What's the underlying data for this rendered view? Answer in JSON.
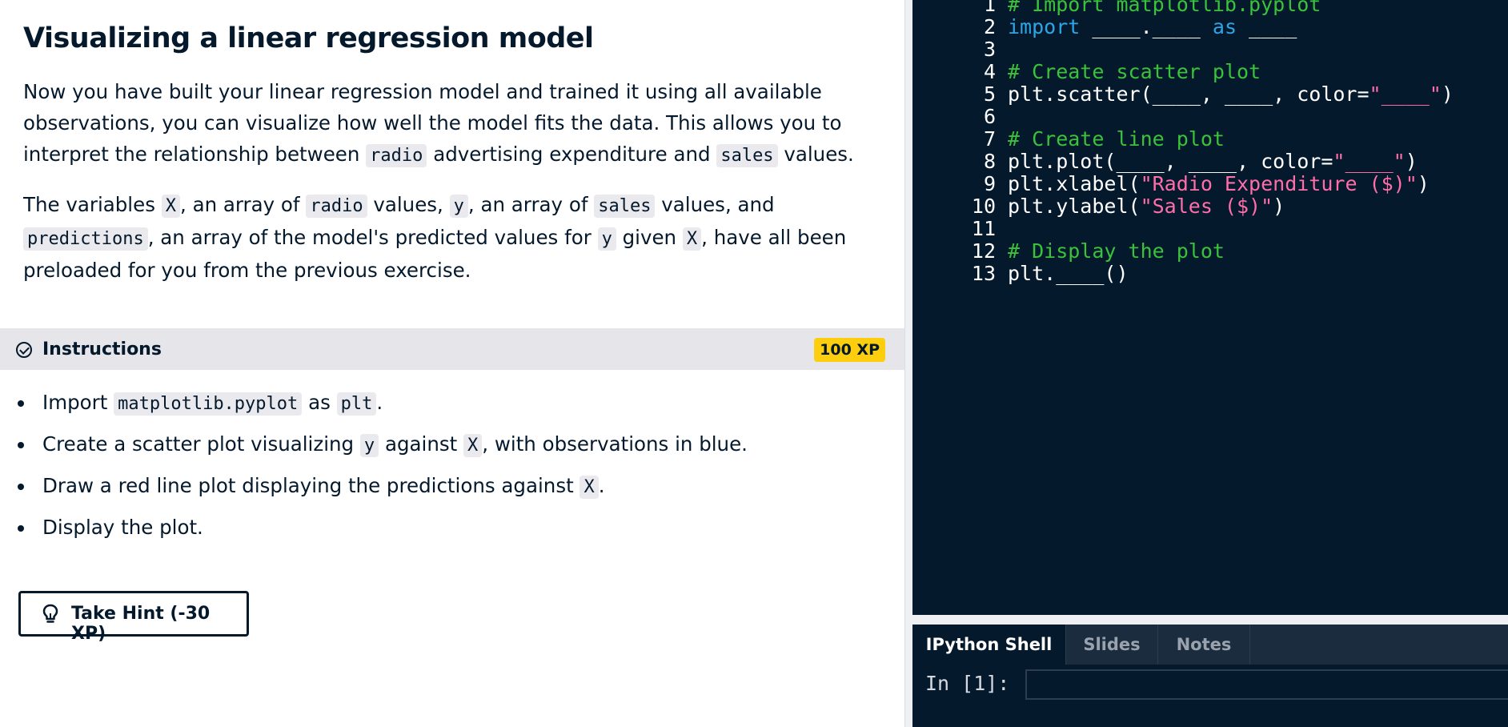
{
  "exercise": {
    "title": "Visualizing a linear regression model",
    "p1": [
      {
        "t": "Now you have built your linear regression model and trained it using all available observations, you can visualize how well the model fits the data. This allows you to interpret the relationship between "
      },
      {
        "c": "radio"
      },
      {
        "t": " advertising expenditure and "
      },
      {
        "c": "sales"
      },
      {
        "t": " values."
      }
    ],
    "p2": [
      {
        "t": "The variables "
      },
      {
        "c": "X"
      },
      {
        "t": ", an array of "
      },
      {
        "c": "radio"
      },
      {
        "t": " values, "
      },
      {
        "c": "y"
      },
      {
        "t": ", an array of "
      },
      {
        "c": "sales"
      },
      {
        "t": " values, and "
      },
      {
        "c": "predictions"
      },
      {
        "t": ", an array of the model's predicted values for "
      },
      {
        "c": "y"
      },
      {
        "t": " given "
      },
      {
        "c": "X"
      },
      {
        "t": ", have all been preloaded for you from the previous exercise."
      }
    ]
  },
  "instructions": {
    "label": "Instructions",
    "xp": "100 XP",
    "items": [
      [
        {
          "t": "Import "
        },
        {
          "c": "matplotlib.pyplot"
        },
        {
          "t": " as "
        },
        {
          "c": "plt"
        },
        {
          "t": "."
        }
      ],
      [
        {
          "t": "Create a scatter plot visualizing "
        },
        {
          "c": "y"
        },
        {
          "t": " against "
        },
        {
          "c": "X"
        },
        {
          "t": ", with observations in blue."
        }
      ],
      [
        {
          "t": "Draw a red line plot displaying the predictions against "
        },
        {
          "c": "X"
        },
        {
          "t": "."
        }
      ],
      [
        {
          "t": "Display the plot."
        }
      ]
    ],
    "hint_button": "Take Hint (-30 XP)"
  },
  "editor": {
    "lines": [
      [
        {
          "k": "comment",
          "t": "# Import matplotlib.pyplot"
        }
      ],
      [
        {
          "k": "kw",
          "t": "import"
        },
        {
          "k": "plain",
          "t": " ____.____ "
        },
        {
          "k": "kw",
          "t": "as"
        },
        {
          "k": "plain",
          "t": " ____"
        }
      ],
      [],
      [
        {
          "k": "comment",
          "t": "# Create scatter plot"
        }
      ],
      [
        {
          "k": "plain",
          "t": "plt.scatter(____, ____, color="
        },
        {
          "k": "str",
          "t": "\"____\""
        },
        {
          "k": "plain",
          "t": ")"
        }
      ],
      [],
      [
        {
          "k": "comment",
          "t": "# Create line plot"
        }
      ],
      [
        {
          "k": "plain",
          "t": "plt.plot(____, ____, color="
        },
        {
          "k": "str",
          "t": "\"____\""
        },
        {
          "k": "plain",
          "t": ")"
        }
      ],
      [
        {
          "k": "plain",
          "t": "plt.xlabel("
        },
        {
          "k": "str",
          "t": "\"Radio Expenditure ($)\""
        },
        {
          "k": "plain",
          "t": ")"
        }
      ],
      [
        {
          "k": "plain",
          "t": "plt.ylabel("
        },
        {
          "k": "str",
          "t": "\"Sales ($)\""
        },
        {
          "k": "plain",
          "t": ")"
        }
      ],
      [],
      [
        {
          "k": "comment",
          "t": "# Display the plot"
        }
      ],
      [
        {
          "k": "plain",
          "t": "plt.____()"
        }
      ]
    ]
  },
  "shell": {
    "tabs": [
      "IPython Shell",
      "Slides",
      "Notes"
    ],
    "active_tab": "IPython Shell",
    "prompt": "In [1]:"
  },
  "colors": {
    "editor_bg": "#05192d",
    "comment": "#3ac23a",
    "keyword": "#2ea5e6",
    "string": "#ff6ea9",
    "xp_badge": "#fcce0d"
  }
}
